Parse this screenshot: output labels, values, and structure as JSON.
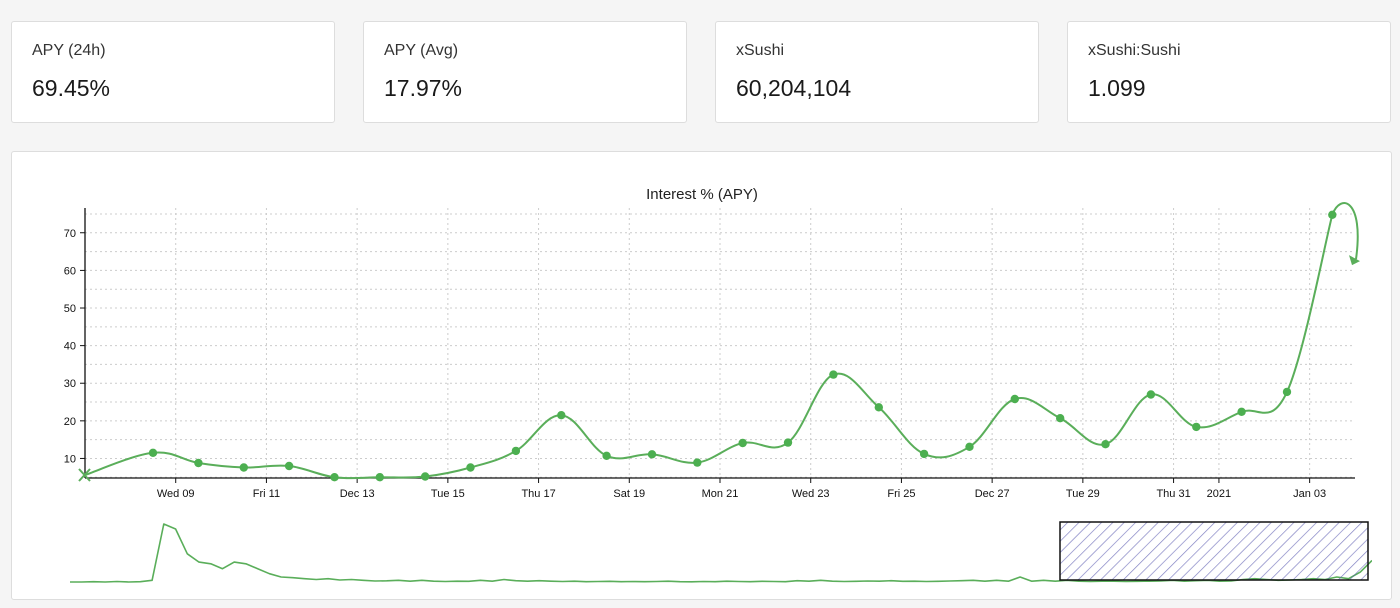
{
  "stats": [
    {
      "label": "APY (24h)",
      "value": "69.45%"
    },
    {
      "label": "APY (Avg)",
      "value": "17.97%"
    },
    {
      "label": "xSushi",
      "value": "60,204,104"
    },
    {
      "label": "xSushi:Sushi",
      "value": "1.099"
    }
  ],
  "colors": {
    "series": "#5aae5a",
    "series_point": "#4caf50",
    "grid": "#cccccc",
    "brush": "#5a5ab0"
  },
  "chart_data": {
    "type": "line",
    "title": "Interest % (APY)",
    "xlabel": "",
    "ylabel": "",
    "x_unit": "date",
    "x_range": [
      "2020-12-07",
      "2021-01-04"
    ],
    "ylim": [
      4.8,
      75
    ],
    "y_ticks": [
      10,
      20,
      30,
      40,
      50,
      60,
      70
    ],
    "x_ticks": [
      {
        "date": "2020-12-09",
        "label": "Wed 09"
      },
      {
        "date": "2020-12-11",
        "label": "Fri 11"
      },
      {
        "date": "2020-12-13",
        "label": "Dec 13"
      },
      {
        "date": "2020-12-15",
        "label": "Tue 15"
      },
      {
        "date": "2020-12-17",
        "label": "Thu 17"
      },
      {
        "date": "2020-12-19",
        "label": "Sat 19"
      },
      {
        "date": "2020-12-21",
        "label": "Mon 21"
      },
      {
        "date": "2020-12-23",
        "label": "Wed 23"
      },
      {
        "date": "2020-12-25",
        "label": "Fri 25"
      },
      {
        "date": "2020-12-27",
        "label": "Dec 27"
      },
      {
        "date": "2020-12-29",
        "label": "Tue 29"
      },
      {
        "date": "2020-12-31",
        "label": "Thu 31"
      },
      {
        "date": "2021-01-01",
        "label": "2021"
      },
      {
        "date": "2021-01-03",
        "label": "Jan 03"
      }
    ],
    "grid": true,
    "legend": "none",
    "series": [
      {
        "points": [
          {
            "x": "2020-12-08 12:00",
            "y": 11.5
          },
          {
            "x": "2020-12-09 12:00",
            "y": 8.8
          },
          {
            "x": "2020-12-10 12:00",
            "y": 7.6
          },
          {
            "x": "2020-12-11 12:00",
            "y": 8.0
          },
          {
            "x": "2020-12-12 12:00",
            "y": 5.0
          },
          {
            "x": "2020-12-13 12:00",
            "y": 5.0
          },
          {
            "x": "2020-12-14 12:00",
            "y": 5.2
          },
          {
            "x": "2020-12-15 12:00",
            "y": 7.6
          },
          {
            "x": "2020-12-16 12:00",
            "y": 12.0
          },
          {
            "x": "2020-12-17 12:00",
            "y": 21.5
          },
          {
            "x": "2020-12-18 12:00",
            "y": 10.7
          },
          {
            "x": "2020-12-19 12:00",
            "y": 11.1
          },
          {
            "x": "2020-12-20 12:00",
            "y": 8.9
          },
          {
            "x": "2020-12-21 12:00",
            "y": 14.1
          },
          {
            "x": "2020-12-22 12:00",
            "y": 14.2
          },
          {
            "x": "2020-12-23 12:00",
            "y": 32.3
          },
          {
            "x": "2020-12-24 12:00",
            "y": 23.6
          },
          {
            "x": "2020-12-25 12:00",
            "y": 11.2
          },
          {
            "x": "2020-12-26 12:00",
            "y": 13.1
          },
          {
            "x": "2020-12-27 12:00",
            "y": 25.8
          },
          {
            "x": "2020-12-28 12:00",
            "y": 20.7
          },
          {
            "x": "2020-12-29 12:00",
            "y": 13.8
          },
          {
            "x": "2020-12-30 12:00",
            "y": 27.0
          },
          {
            "x": "2020-12-31 12:00",
            "y": 18.4
          },
          {
            "x": "2021-01-01 12:00",
            "y": 22.4
          },
          {
            "x": "2021-01-02 12:00",
            "y": 27.7
          },
          {
            "x": "2021-01-03 12:00",
            "y": 74.8
          }
        ]
      }
    ],
    "overview": {
      "brush_range": [
        "2020-12-07",
        "2021-01-04"
      ],
      "values": [
        5,
        5,
        5.2,
        5,
        5.3,
        5,
        5.2,
        6,
        40,
        37,
        22,
        17,
        16,
        13,
        17,
        16,
        13,
        10,
        8,
        7.6,
        7,
        6.5,
        7,
        6.2,
        6.5,
        6,
        5.6,
        5.7,
        6,
        5.5,
        6,
        5.5,
        5.3,
        5.5,
        5.4,
        6,
        5.5,
        6.5,
        5.8,
        5.5,
        5.8,
        5.5,
        5.3,
        5.5,
        5.2,
        5.3,
        5.4,
        5.2,
        5.3,
        5.2,
        5.3,
        5.5,
        5.2,
        5.1,
        5.3,
        5.2,
        5.5,
        5.3,
        5.2,
        5.4,
        5.3,
        5.2,
        5.8,
        5.5,
        6,
        5.5,
        5.3,
        5.4,
        5.6,
        5.5,
        5.8,
        5.4,
        5.5,
        5.3,
        5.4,
        5.6,
        5.8,
        6,
        5.5,
        6,
        5.5,
        8,
        5.5,
        6,
        5.5,
        6,
        5.5,
        5.3,
        5.5,
        5.5,
        5.3,
        5.4,
        5.5,
        5.6,
        6,
        5.5,
        5.8,
        6,
        5.5,
        5.6,
        6.5,
        7,
        6.5,
        6,
        6.2,
        6.5,
        7,
        6.5,
        8,
        7,
        11,
        18
      ]
    }
  }
}
